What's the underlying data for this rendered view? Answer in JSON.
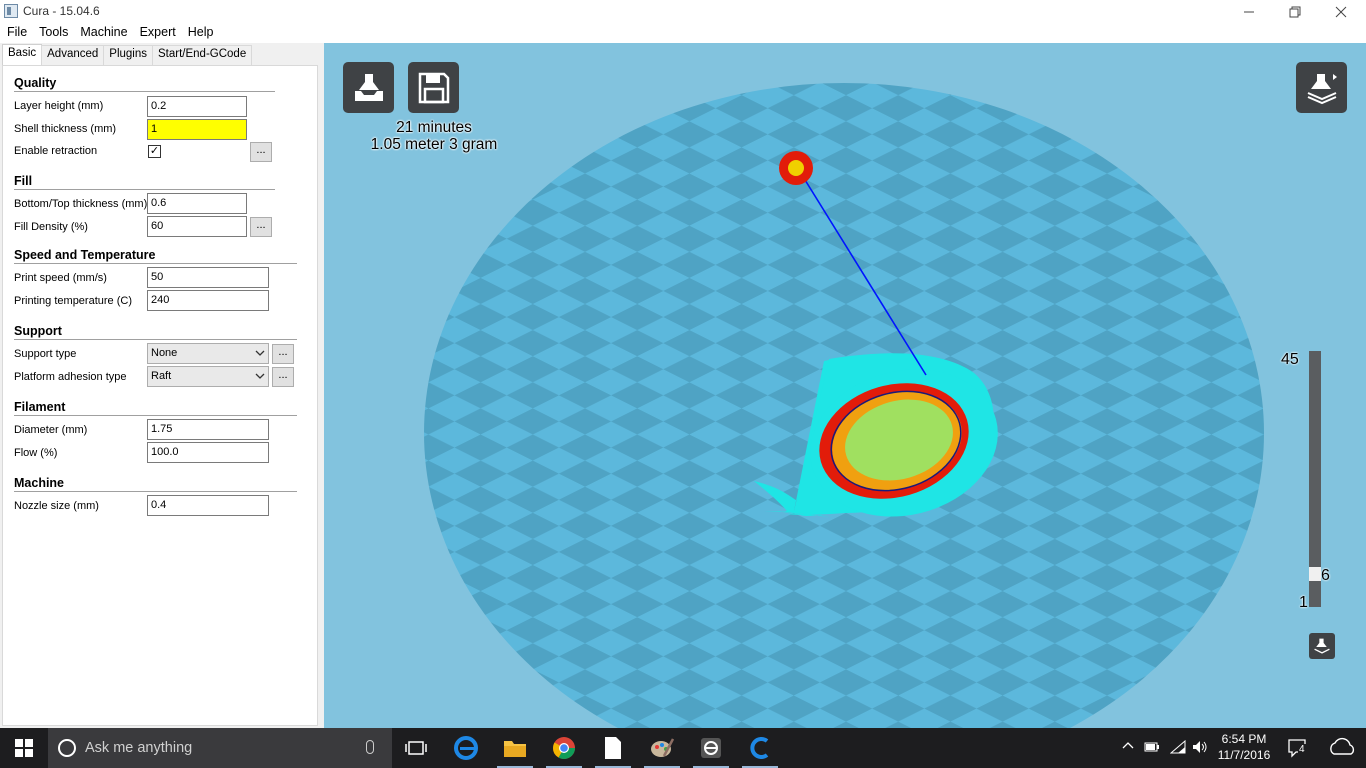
{
  "window": {
    "title": "Cura - 15.04.6"
  },
  "menu": [
    "File",
    "Tools",
    "Machine",
    "Expert",
    "Help"
  ],
  "tabs": [
    "Basic",
    "Advanced",
    "Plugins",
    "Start/End-GCode"
  ],
  "sections": {
    "quality": "Quality",
    "fill": "Fill",
    "speed": "Speed and Temperature",
    "support": "Support",
    "filament": "Filament",
    "machine": "Machine"
  },
  "fields": {
    "layer_height": {
      "label": "Layer height (mm)",
      "value": "0.2"
    },
    "shell_thickness": {
      "label": "Shell thickness (mm)",
      "value": "1"
    },
    "enable_retraction": {
      "label": "Enable retraction",
      "checked": true,
      "check": "✓"
    },
    "bottom_top": {
      "label": "Bottom/Top thickness (mm)",
      "value": "0.6"
    },
    "fill_density": {
      "label": "Fill Density (%)",
      "value": "60"
    },
    "print_speed": {
      "label": "Print speed (mm/s)",
      "value": "50"
    },
    "print_temp": {
      "label": "Printing temperature (C)",
      "value": "240"
    },
    "support_type": {
      "label": "Support type",
      "value": "None"
    },
    "adhesion": {
      "label": "Platform adhesion type",
      "value": "Raft"
    },
    "diameter": {
      "label": "Diameter (mm)",
      "value": "1.75"
    },
    "flow": {
      "label": "Flow (%)",
      "value": "100.0"
    },
    "nozzle": {
      "label": "Nozzle size (mm)",
      "value": "0.4"
    }
  },
  "more_label": "...",
  "viewport": {
    "print_time": "21 minutes",
    "print_material": "1.05 meter 3 gram",
    "layer_max": "45",
    "layer_current": "6",
    "layer_min": "1",
    "layer_fraction": 0.114
  },
  "taskbar": {
    "search_placeholder": "Ask me anything",
    "time": "6:54 PM",
    "date": "11/7/2016",
    "notification_count": "4"
  },
  "colors": {
    "viewport_bg": "#82c3de",
    "bed_light": "#5cb8dc",
    "bed_dark": "#4fa3c4",
    "highlight_field": "#ffff00",
    "model_red": "#e21c0a",
    "model_cyan": "#1fe5e5",
    "infill_green": "#a0e060",
    "travel_blue": "#0015ff"
  }
}
